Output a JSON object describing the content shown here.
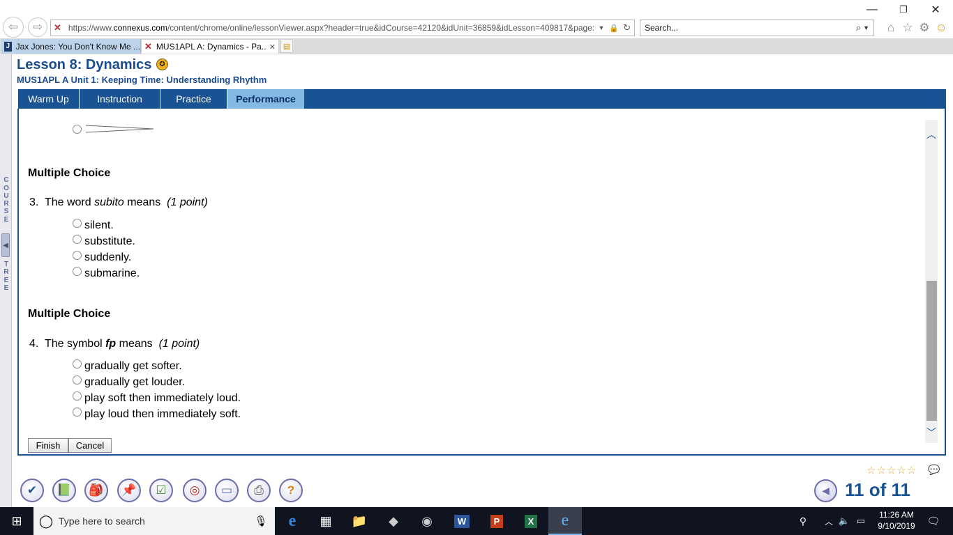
{
  "browser": {
    "url": "https://www.connexus.com/content/chrome/online/lessonViewer.aspx?header=true&idCourse=42120&idUnit=36859&idLesson=409817&page",
    "url_host": "https://www.",
    "url_domain": "connexus.com",
    "url_path": "/content/chrome/online/lessonViewer.aspx?header=true&idCourse=42120&idUnit=36859&idLesson=409817&page:",
    "search_placeholder": "Search...",
    "tabs": [
      {
        "label": "Jax Jones: You Don't Know Me ...",
        "active": false
      },
      {
        "label": "MUS1APL A: Dynamics - Pa...",
        "active": true
      }
    ]
  },
  "course_tree": {
    "letters_top": [
      "C",
      "O",
      "U",
      "R",
      "S",
      "E"
    ],
    "letters_bottom": [
      "T",
      "R",
      "E",
      "E"
    ]
  },
  "lesson": {
    "title": "Lesson 8: Dynamics",
    "subtitle": "MUS1APL A  Unit 1: Keeping Time: Understanding Rhythm"
  },
  "nav_tabs": [
    {
      "label": "Warm Up",
      "active": false
    },
    {
      "label": "Instruction",
      "active": false
    },
    {
      "label": "Practice",
      "active": false
    },
    {
      "label": "Performance",
      "active": true
    }
  ],
  "questions": [
    {
      "heading": "Multiple Choice",
      "number": "3.",
      "prefix": "The word ",
      "term": "subito",
      "suffix": " means",
      "points": "(1 point)",
      "options": [
        "silent.",
        "substitute.",
        "suddenly.",
        "submarine."
      ]
    },
    {
      "heading": "Multiple Choice",
      "number": "4.",
      "prefix": "The symbol ",
      "term": "fp",
      "suffix": " means",
      "points": "(1 point)",
      "options": [
        "gradually get softer.",
        "gradually get louder.",
        "play soft then immediately loud.",
        "play loud then immediately soft."
      ]
    }
  ],
  "buttons": {
    "finish": "Finish",
    "cancel": "Cancel"
  },
  "footer": {
    "page_indicator": "11 of 11",
    "rating_stars": "☆☆☆☆☆"
  },
  "taskbar": {
    "search_placeholder": "Type here to search",
    "time": "11:26 AM",
    "date": "9/10/2019"
  }
}
